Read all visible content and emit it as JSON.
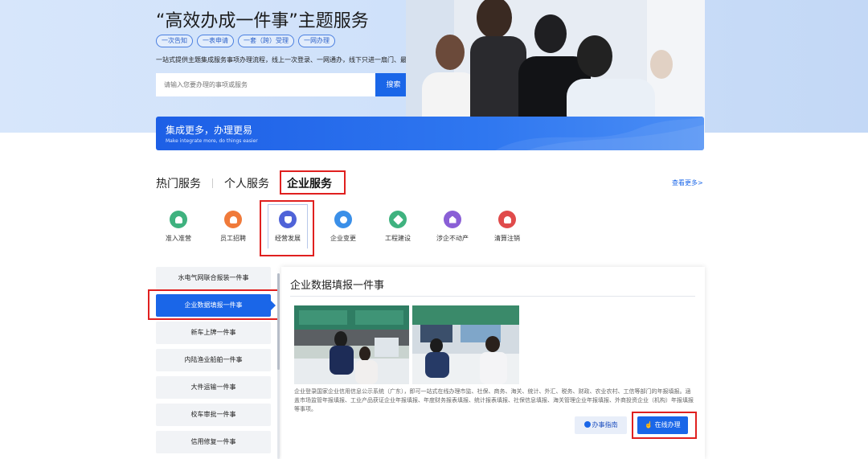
{
  "hero": {
    "title": "“高效办成一件事”主题服务",
    "tags": [
      "一次告知",
      "一表申请",
      "一套（跨）受理",
      "一网办理"
    ],
    "desc": "一站式提供主题集成服务事项办理流程，线上一次登录、一网通办，线下只进一扇门、最多跑一次",
    "search_placeholder": "请输入您要办理的事项或服务",
    "search_button": "搜索"
  },
  "banner": {
    "title": "集成更多，办理更易",
    "subtitle": "Make integrate more, do things easier"
  },
  "tabs": {
    "items": [
      "热门服务",
      "个人服务",
      "企业服务"
    ],
    "active": "企业服务",
    "more": "查看更多>"
  },
  "categories": [
    {
      "label": "准入准营",
      "color": "#3fb27f"
    },
    {
      "label": "员工招聘",
      "color": "#f07a3a"
    },
    {
      "label": "经营发展",
      "color": "#4f63d8"
    },
    {
      "label": "企业变更",
      "color": "#3a8fe8"
    },
    {
      "label": "工程建设",
      "color": "#3fb27f"
    },
    {
      "label": "涉企不动产",
      "color": "#8a5fd6"
    },
    {
      "label": "清算注销",
      "color": "#e04b4b"
    }
  ],
  "active_category": "经营发展",
  "side_list": [
    "水电气网联合报装一件事",
    "企业数据填报一件事",
    "新车上牌一件事",
    "内陆渔业船舶一件事",
    "大件运输一件事",
    "校车审批一件事",
    "信用修复一件事"
  ],
  "active_item": "企业数据填报一件事",
  "detail": {
    "title": "企业数据填报一件事",
    "description": "企业登录国家企业信用信息公示系统（广东），即可一站式在线办理市监、社保、商务、海关、统计、外汇、税务、财政、农业农村、工信等部门的年报填报。涵盖市场监管年报填报、工业产品获证企业年报填报、年度财务报表填报、统计报表填报、社保信息填报、海关管理企业年报填报、外商投资企业（机构）年报填报等事项。",
    "guide_button": "办事指南",
    "online_button": "在线办理"
  },
  "colors": {
    "primary": "#1a66e8",
    "highlight": "#e0201f"
  }
}
